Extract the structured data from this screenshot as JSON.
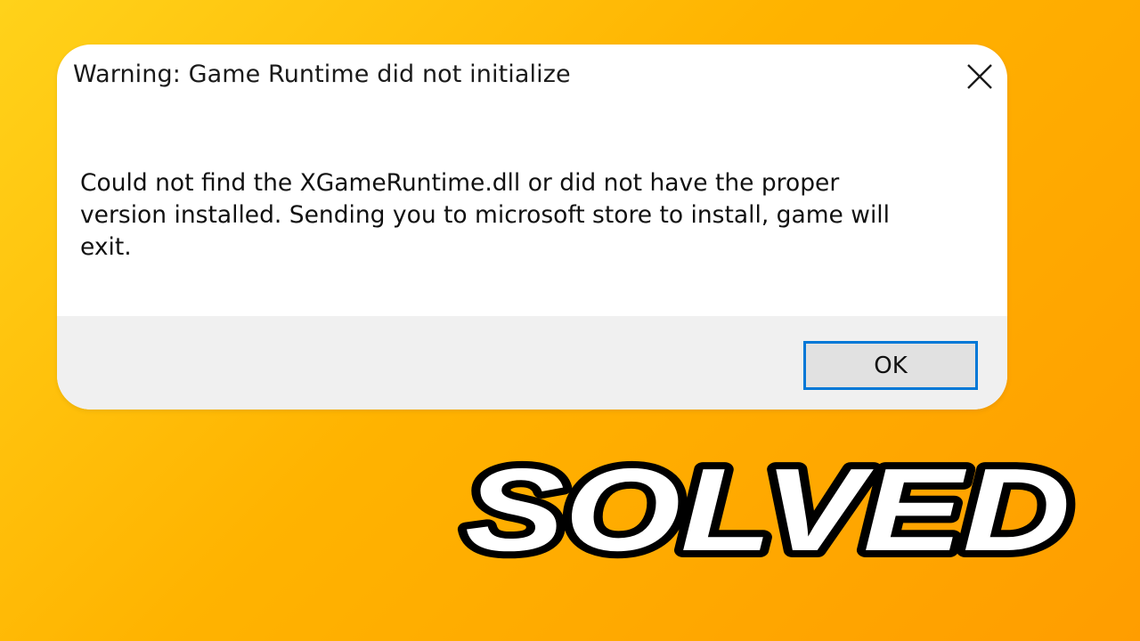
{
  "background": {
    "gradient_colors": [
      "#ffd21a",
      "#ffb300",
      "#ff9d00"
    ]
  },
  "dialog": {
    "title": "Warning: Game Runtime did not initialize",
    "message": "Could not find the XGameRuntime.dll or did not have the proper\nversion installed.  Sending you to microsoft store to install, game will\nexit.",
    "close_icon": "close-x-icon",
    "ok_label": "OK",
    "accent_color": "#0078d7"
  },
  "overlay": {
    "headline": "SOLVED",
    "text_color": "#ffffff",
    "outline_color": "#000000"
  }
}
